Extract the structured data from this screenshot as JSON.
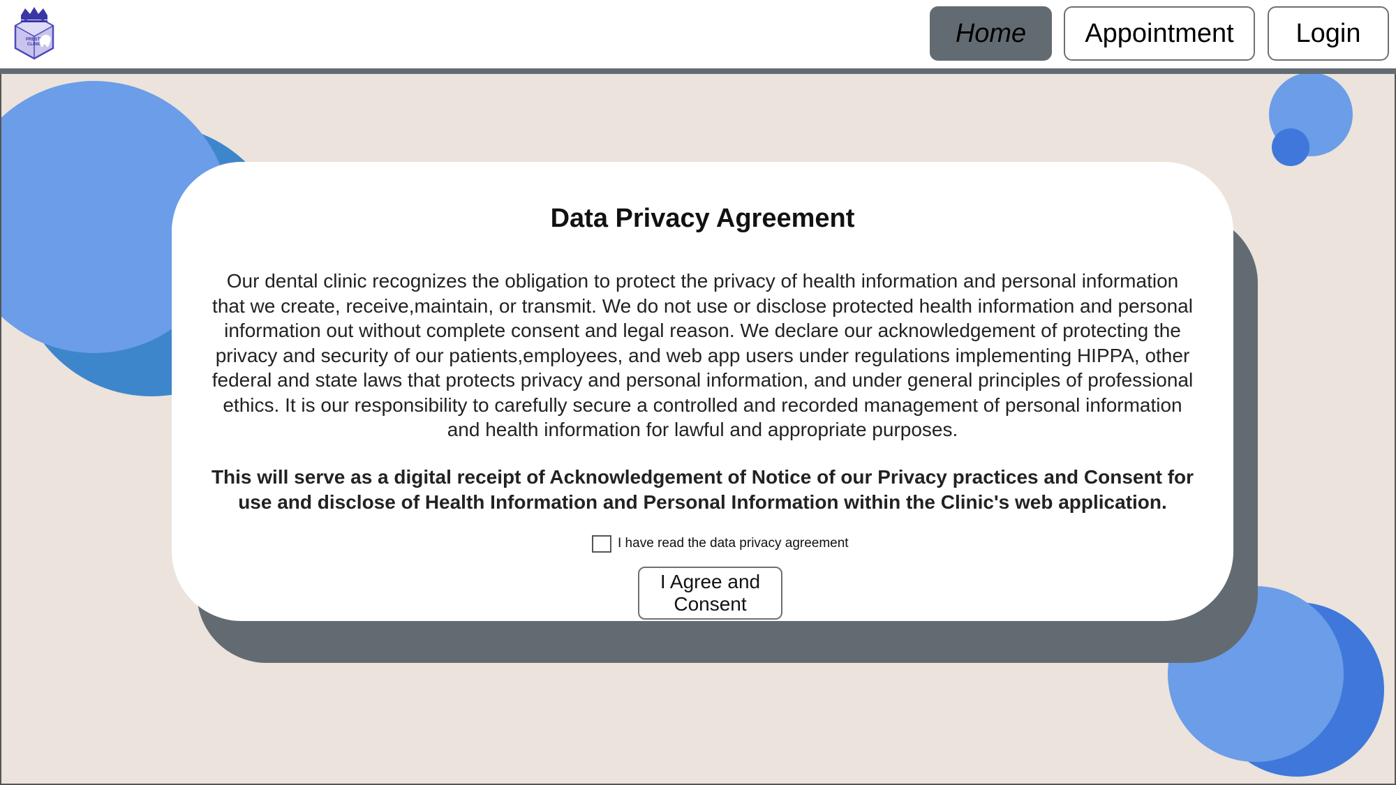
{
  "nav": {
    "home_label": "Home",
    "appointment_label": "Appointment",
    "login_label": "Login"
  },
  "logo": {
    "text_line1": "PRESTIGE",
    "text_line2": "CLINIC"
  },
  "colors": {
    "nav_active": "#636b72",
    "background": "#ebe3dc",
    "accent_blue": "#6b9de8",
    "accent_blue_dark": "#3f78da"
  },
  "agreement": {
    "title": "Data Privacy Agreement",
    "body": "Our dental clinic recognizes the obligation to protect the privacy of health information and personal information that we create, receive,maintain, or transmit. We do not use or disclose protected health information and personal information out without complete consent and legal reason. We declare our acknowledgement of protecting the privacy and security of our patients,employees, and web app users under regulations implementing HIPPA, other federal and state laws that protects privacy and personal information, and under general principles of professional ethics. It is our responsibility to carefully secure a controlled and recorded management of personal information and health information for lawful and appropriate purposes.",
    "notice": "This will serve as a digital receipt of Acknowledgement of Notice of our Privacy practices and Consent for use and disclose of Health Information and Personal Information within the Clinic's web application.",
    "checkbox_label": "I have read the data privacy agreement",
    "checkbox_checked": false,
    "button_label": "I Agree and Consent"
  }
}
